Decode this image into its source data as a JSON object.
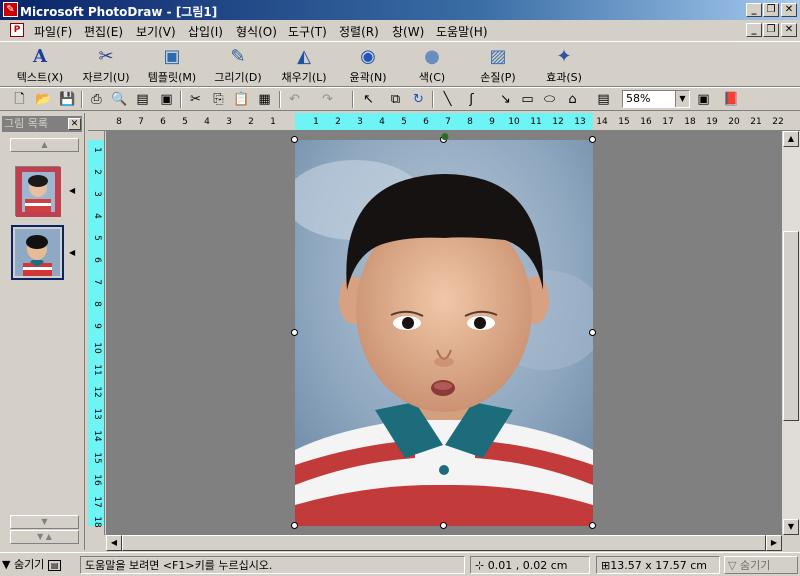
{
  "window": {
    "title": "Microsoft PhotoDraw - [그림1]",
    "controls": [
      "_",
      "❐",
      "✕"
    ]
  },
  "menu": [
    "파일(F)",
    "편집(E)",
    "보기(V)",
    "삽입(I)",
    "형식(O)",
    "도구(T)",
    "정렬(R)",
    "창(W)",
    "도움말(H)"
  ],
  "big_toolbar": [
    {
      "label": "텍스트(X)",
      "icon": "text-icon"
    },
    {
      "label": "자르기(U)",
      "icon": "scissors-icon"
    },
    {
      "label": "템플릿(M)",
      "icon": "template-icon"
    },
    {
      "label": "그리기(D)",
      "icon": "pencil-icon"
    },
    {
      "label": "채우기(L)",
      "icon": "paint-bucket-icon"
    },
    {
      "label": "윤곽(N)",
      "icon": "outline-icon"
    },
    {
      "label": "색(C)",
      "icon": "color-icon"
    },
    {
      "label": "손질(P)",
      "icon": "touchup-icon"
    },
    {
      "label": "효과(S)",
      "icon": "effects-icon"
    }
  ],
  "zoom": "58%",
  "panel": {
    "title": "그림 목록",
    "close": "✕"
  },
  "rulers": {
    "h_labels": [
      "8",
      "7",
      "6",
      "5",
      "4",
      "3",
      "2",
      "1",
      "1",
      "2",
      "3",
      "4",
      "5",
      "6",
      "7",
      "8",
      "9",
      "10",
      "11",
      "12",
      "13",
      "14",
      "15",
      "16",
      "17",
      "18",
      "19",
      "20",
      "21",
      "22"
    ],
    "v_labels": [
      "1",
      "2",
      "3",
      "4",
      "5",
      "6",
      "7",
      "8",
      "9",
      "10",
      "11",
      "12",
      "13",
      "14",
      "15",
      "16",
      "17",
      "18"
    ]
  },
  "status": {
    "hide": "숨기기",
    "help": "도움말을 보려면 <F1>키를 누르십시오.",
    "position": "0.01 , 0.02 cm",
    "size": "13.57 x 17.57 cm",
    "hide_right": "숨기기"
  }
}
